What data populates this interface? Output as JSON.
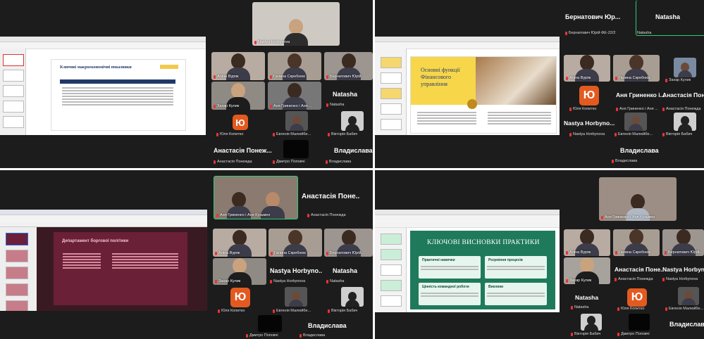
{
  "q1": {
    "slide_title": "Ключові макроекономічні показники",
    "top_person": "Nastya Horbynova",
    "tiles": [
      "Аліна Вуряк",
      "Галина Скребнюк",
      "Бернатович Юрій",
      "Захар Кулик",
      "Аня Гриненко і Аня ...",
      "Natasha",
      "Юля Копитко",
      "Евгенія Малюйбе...",
      "Вікторія Бабич"
    ],
    "anastasia": "Анастасія Понеж...",
    "anastasia_small": "Анастасія Понежда",
    "vladyslava": "Владислава",
    "dmytro": "Дмитро Поповчі",
    "vladyslava_small": "Владислава"
  },
  "q2": {
    "slide_title": "Основні функції Фінансового управління",
    "top_names": [
      "Бернатович Юр...",
      "Natasha"
    ],
    "top_small": [
      "Бернатович Юрій ФЕ-22/2",
      "Natasha"
    ],
    "tiles": [
      "Аліна Вуряк",
      "Галина Скребнюк",
      "Захар Кулик",
      "Юля Копитко",
      "Аня Гриненко і Аня ...",
      "Анастасія Понежда",
      "Nastya Horbynova",
      "Евгенія Малюйбе...",
      "Вікторія Бабич"
    ],
    "big_names": [
      "Аня Гриненко і...",
      "Анастасія Поне..",
      "Nastya Horbyno..."
    ],
    "vladyslava": "Владислава",
    "vladyslava_small": "Владислава"
  },
  "q3": {
    "slide_title": "Департамент боргової політики",
    "top_tile": "Аня Гриненко і Аня Кузьмен",
    "anastasia": "Анастасія Поне..",
    "anastasia_small": "Анастасія Понежда",
    "tiles": [
      "Аліна Вуряк",
      "Галина Скребнюк",
      "Бернатович Юрій...",
      "Захар Кулик",
      "Юля Копитко",
      "Евгенія Малюйбе...",
      "Вікторія Бабич"
    ],
    "big_names": [
      "Nastya Horbyno..",
      "Natasha"
    ],
    "small_names": [
      "Nastya Horbynova",
      "Natasha"
    ],
    "vladyslava": "Владислава",
    "dmytro": "Дмитро Поповчі",
    "vladyslava_small": "Владислава"
  },
  "q4": {
    "slide_title": "КЛЮЧОВІ ВИСНОВКИ ПРАКТИКИ",
    "boxes": [
      "Практичні навички",
      "Розуміння процесів",
      "Цінність командної роботи",
      "Виклики"
    ],
    "top_tile": "Аня Гриненко і Аня Кузьмен",
    "tiles": [
      "Аліна Вуряк",
      "Галина Скребнюк",
      "Бернатович Юрій...",
      "Захар Кулик",
      "Юля Копитко",
      "Евгенія Малюйбе..."
    ],
    "big_names": [
      "Анастасія Поне..",
      "Nastya Horbyno",
      "Natasha"
    ],
    "small_names": [
      "Анастасія Понежда",
      "Nastya Horbynova",
      "Natasha"
    ],
    "natasha_small": "Natasha",
    "bottom": [
      "Вікторія Бабич",
      "Дмитро Поповчі",
      "Владислава"
    ],
    "avatar_letter": "Ю"
  },
  "avatar_letter": "Ю"
}
